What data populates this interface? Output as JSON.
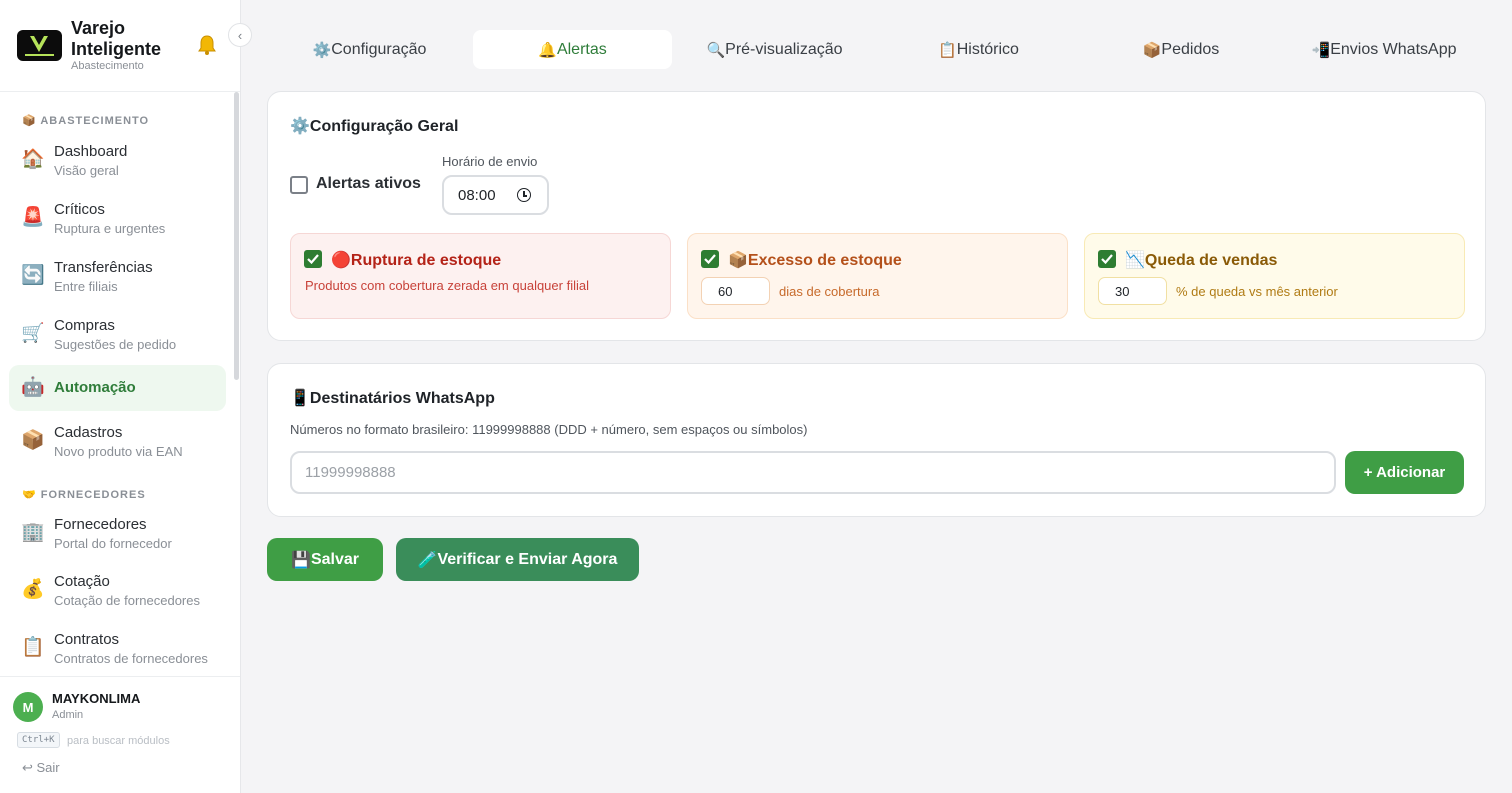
{
  "app": {
    "title": "Varejo Inteligente",
    "subtitle": "Abastecimento",
    "collapse_icon": "‹"
  },
  "sidebar": {
    "sections": [
      {
        "icon": "📦",
        "title": "ABASTECIMENTO"
      },
      {
        "icon": "🤝",
        "title": "FORNECEDORES"
      }
    ],
    "items": [
      {
        "icon": "🏠",
        "label": "Dashboard",
        "sub": "Visão geral"
      },
      {
        "icon": "🚨",
        "label": "Críticos",
        "sub": "Ruptura e urgentes"
      },
      {
        "icon": "🔄",
        "label": "Transferências",
        "sub": "Entre filiais"
      },
      {
        "icon": "🛒",
        "label": "Compras",
        "sub": "Sugestões de pedido"
      },
      {
        "icon": "🤖",
        "label": "Automação",
        "sub": "",
        "active": true
      },
      {
        "icon": "📦",
        "label": "Cadastros",
        "sub": "Novo produto via EAN"
      },
      {
        "icon": "🏢",
        "label": "Fornecedores",
        "sub": "Portal do fornecedor"
      },
      {
        "icon": "💰",
        "label": "Cotação",
        "sub": "Cotação de fornecedores"
      },
      {
        "icon": "📋",
        "label": "Contratos",
        "sub": "Contratos de fornecedores"
      }
    ]
  },
  "user": {
    "initial": "M",
    "name": "MAYKONLIMA",
    "role": "Admin",
    "shortcut": "Ctrl+K",
    "shortcut_hint": "para buscar módulos",
    "logout": "↩ Sair"
  },
  "tabs": [
    {
      "icon": "⚙️",
      "label": "Configuração"
    },
    {
      "icon": "🔔",
      "label": "Alertas",
      "active": true
    },
    {
      "icon": "🔍",
      "label": "Pré-visualização"
    },
    {
      "icon": "📋",
      "label": "Histórico"
    },
    {
      "icon": "📦",
      "label": "Pedidos"
    },
    {
      "icon": "📲",
      "label": "Envios WhatsApp"
    }
  ],
  "config": {
    "title_icon": "⚙️",
    "title": "Configuração Geral",
    "alerts_enabled_label": "Alertas ativos",
    "alerts_enabled": false,
    "send_time_label": "Horário de envio",
    "send_time": "08:00",
    "alerts": [
      {
        "icon": "🔴",
        "title": "Ruptura de estoque",
        "desc": "Produtos com cobertura zerada em qualquer filial",
        "checked": true,
        "bg": "#fdf1f0",
        "border": "#f6d7d5",
        "title_color": "#b42318",
        "text_color": "#c8433a"
      },
      {
        "icon": "📦",
        "title": "Excesso de estoque",
        "value": "60",
        "unit": "dias de cobertura",
        "checked": true,
        "bg": "#fff5ec",
        "border": "#fbe0c7",
        "title_color": "#b4501a",
        "text_color": "#c76a2b"
      },
      {
        "icon": "📉",
        "title": "Queda de vendas",
        "value": "30",
        "unit": "% de queda vs mês anterior",
        "checked": true,
        "bg": "#fffbea",
        "border": "#f8eab5",
        "title_color": "#8a5a06",
        "text_color": "#b07b14"
      }
    ]
  },
  "whatsapp": {
    "title_icon": "📱",
    "title": "Destinatários WhatsApp",
    "hint": "Números no formato brasileiro: 11999998888 (DDD + número, sem espaços ou símbolos)",
    "placeholder": "11999998888",
    "add_label": "+ Adicionar"
  },
  "actions": {
    "save_icon": "💾",
    "save_label": "Salvar",
    "verify_icon": "🧪",
    "verify_label": "Verificar e Enviar Agora"
  },
  "colors": {
    "accent": "#2f7d3a",
    "primary_button": "#3f9e45",
    "secondary_button": "#3a8d5a"
  }
}
